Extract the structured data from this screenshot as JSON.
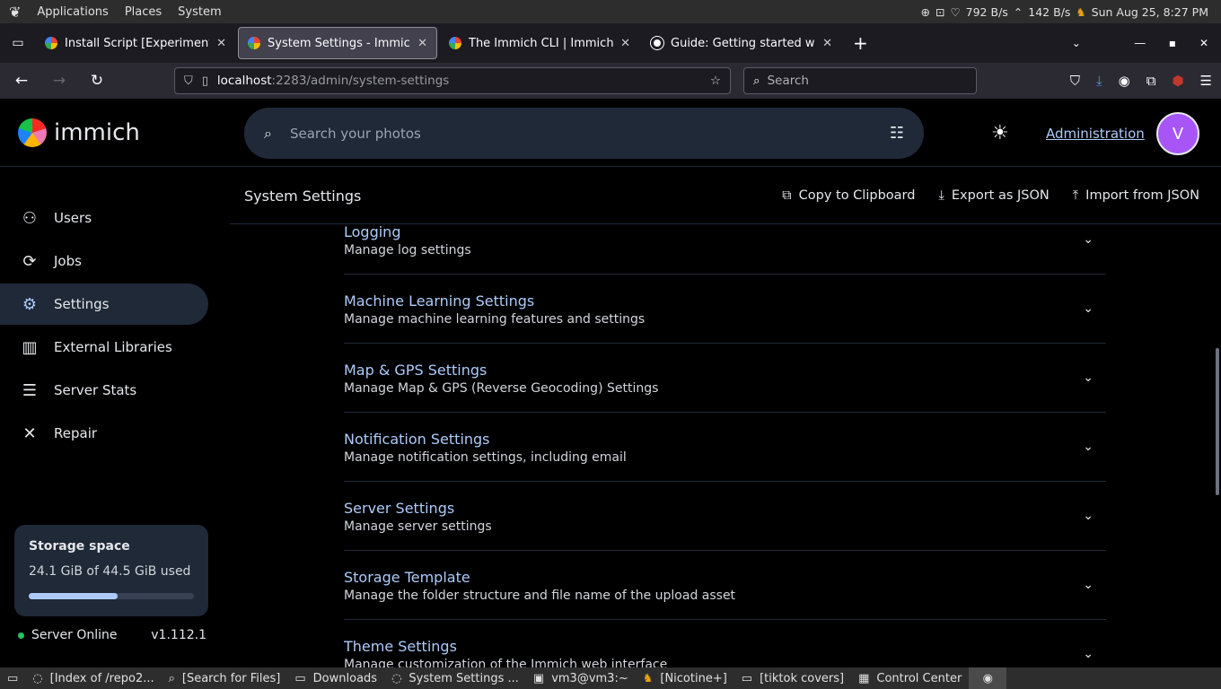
{
  "gnome": {
    "menu_applications": "Applications",
    "menu_places": "Places",
    "menu_system": "System",
    "net_down": "792 B/s",
    "net_up": "142 B/s",
    "clock": "Sun Aug 25,  8:27 PM"
  },
  "browser": {
    "tabs": [
      {
        "title": "Install Script [Experimental]"
      },
      {
        "title": "System Settings - Immich"
      },
      {
        "title": "The Immich CLI | Immich"
      },
      {
        "title": "Guide: Getting started with"
      }
    ],
    "url_host": "localhost",
    "url_path": ":2283/admin/system-settings",
    "search_placeholder": "Search"
  },
  "app": {
    "logo_text": "immich",
    "photo_search_placeholder": "Search your photos",
    "admin_link": "Administration",
    "avatar_initial": "V"
  },
  "sidebar": {
    "items": [
      {
        "label": "Users",
        "icon": "users-icon"
      },
      {
        "label": "Jobs",
        "icon": "sync-icon"
      },
      {
        "label": "Settings",
        "icon": "gear-icon"
      },
      {
        "label": "External Libraries",
        "icon": "library-icon"
      },
      {
        "label": "Server Stats",
        "icon": "server-icon"
      },
      {
        "label": "Repair",
        "icon": "tools-icon"
      }
    ],
    "storage_label": "Storage space",
    "storage_used": "24.1 GiB of 44.5 GiB used",
    "storage_fraction": 0.54,
    "server_status": "Server Online",
    "version": "v1.112.1"
  },
  "main": {
    "title": "System Settings",
    "copy_label": "Copy to Clipboard",
    "export_label": "Export as JSON",
    "import_label": "Import from JSON",
    "settings": [
      {
        "title": "Logging",
        "desc": "Manage log settings"
      },
      {
        "title": "Machine Learning Settings",
        "desc": "Manage machine learning features and settings"
      },
      {
        "title": "Map & GPS Settings",
        "desc": "Manage Map & GPS (Reverse Geocoding) Settings"
      },
      {
        "title": "Notification Settings",
        "desc": "Manage notification settings, including email"
      },
      {
        "title": "Server Settings",
        "desc": "Manage server settings"
      },
      {
        "title": "Storage Template",
        "desc": "Manage the folder structure and file name of the upload asset"
      },
      {
        "title": "Theme Settings",
        "desc": "Manage customization of the Immich web interface"
      }
    ]
  },
  "taskbar": {
    "items": [
      {
        "label": "[Index of /repo2..."
      },
      {
        "label": "[Search for Files]"
      },
      {
        "label": "Downloads"
      },
      {
        "label": "System Settings ..."
      },
      {
        "label": "vm3@vm3:~"
      },
      {
        "label": "[Nicotine+]"
      },
      {
        "label": "[tiktok covers]"
      },
      {
        "label": "Control Center"
      }
    ]
  },
  "colors": {
    "accent": "#adcbfa",
    "avatar_bg": "#a855f7",
    "online": "#22c55e"
  }
}
